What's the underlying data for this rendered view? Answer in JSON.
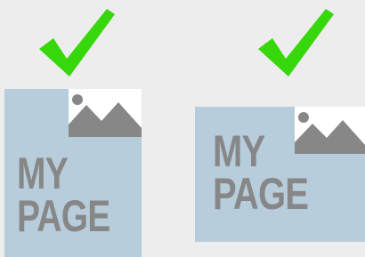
{
  "colors": {
    "background": "#ededed",
    "check": "#36d70b",
    "page": "#b7cddb",
    "text": "#878787",
    "thumbnail": "#ffffff",
    "thumbnail_art": "#878787"
  },
  "icons": {
    "check": "check-icon",
    "image": "image-placeholder-icon"
  },
  "examples": [
    {
      "orientation": "portrait",
      "status": "correct",
      "text": [
        "MY",
        "PAGE"
      ]
    },
    {
      "orientation": "landscape",
      "status": "correct",
      "text": [
        "MY",
        "PAGE"
      ]
    }
  ]
}
